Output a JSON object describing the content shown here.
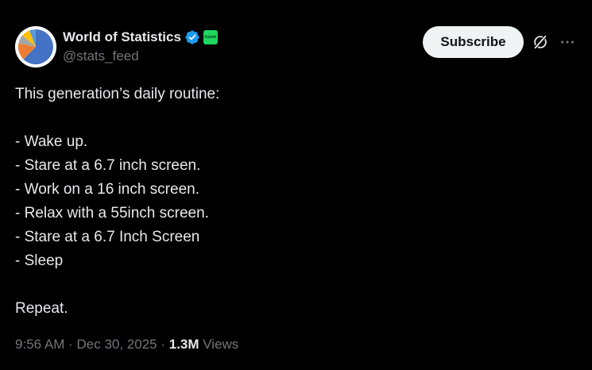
{
  "author": {
    "display_name": "World of Statistics",
    "handle": "@stats_feed",
    "affiliate_badge_text": "Kalshi",
    "verified_color": "#1d9bf0"
  },
  "actions": {
    "subscribe_label": "Subscribe",
    "grok_icon": "grok-icon",
    "more_icon": "more-icon"
  },
  "post": {
    "lines": [
      "This generation’s daily routine:",
      "",
      "- Wake up.",
      "- Stare at a 6.7 inch screen.",
      "- Work on a 16 inch screen.",
      "- Relax with a 55inch screen.",
      "- Stare at a 6.7 Inch Screen",
      "- Sleep",
      "",
      "Repeat."
    ]
  },
  "meta": {
    "time": "9:56 AM",
    "separator": " · ",
    "date": "Dec 30, 2025",
    "views_count": "1.3M",
    "views_label": " Views"
  },
  "colors": {
    "background": "#000000",
    "text": "#e7e9ea",
    "muted": "#71767b",
    "button_bg": "#eff3f4",
    "button_text": "#0f1419",
    "affiliate_green": "#1ed760"
  }
}
